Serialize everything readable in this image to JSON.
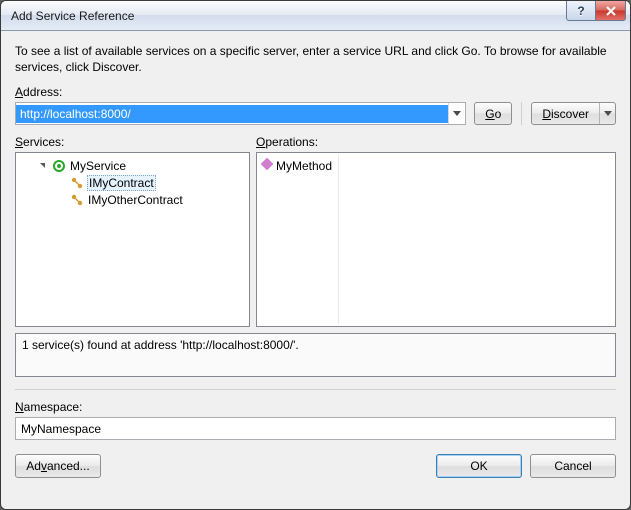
{
  "window": {
    "title": "Add Service Reference"
  },
  "instructions": "To see a list of available services on a specific server, enter a service URL and click Go. To browse for available services, click Discover.",
  "labels": {
    "address_u": "A",
    "address_rest": "ddress:",
    "services_u": "S",
    "services_rest": "ervices:",
    "operations_u": "O",
    "operations_rest": "perations:",
    "namespace_u": "N",
    "namespace_rest": "amespace:"
  },
  "address": {
    "value": "http://localhost:8000/"
  },
  "buttons": {
    "go_u": "G",
    "go_rest": "o",
    "discover_u": "D",
    "discover_rest": "iscover",
    "advanced": "Ad",
    "advanced_u": "v",
    "advanced_rest": "anced...",
    "ok": "OK",
    "cancel": "Cancel"
  },
  "services_tree": {
    "root": "MyService",
    "children": [
      "IMyContract",
      "IMyOtherContract"
    ],
    "selected_index": 0
  },
  "operations": {
    "items": [
      "MyMethod"
    ]
  },
  "status": "1 service(s) found at address 'http://localhost:8000/'.",
  "namespace": {
    "value": "MyNamespace"
  }
}
